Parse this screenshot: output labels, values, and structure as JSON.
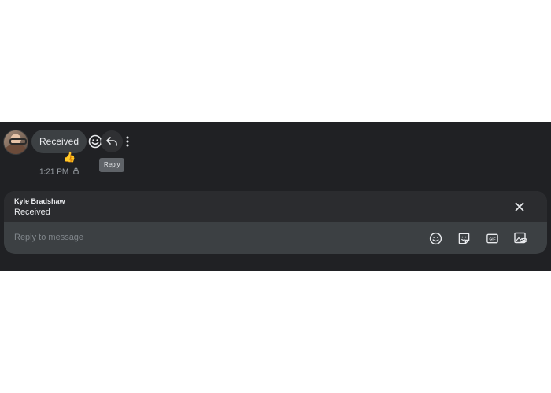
{
  "message": {
    "text": "Received",
    "reaction": "👍",
    "time": "1:21 PM"
  },
  "actions": {
    "tooltip": "Reply"
  },
  "composer": {
    "quote_author": "Kyle Bradshaw",
    "quote_text": "Received",
    "placeholder": "Reply to message",
    "gif_label": "GIF"
  },
  "icons": {
    "emoji": "emoji-icon",
    "reply": "reply-icon",
    "more": "more-vert-icon",
    "close": "close-icon",
    "sticker": "sticker-icon",
    "gif": "gif-icon",
    "image": "image-icon",
    "lock": "lock-icon"
  },
  "colors": {
    "background": "#202124",
    "bubble": "#3c4043",
    "quote_bar": "#2b2c2f",
    "text": "#e8eaed",
    "muted": "#9aa0a6"
  }
}
